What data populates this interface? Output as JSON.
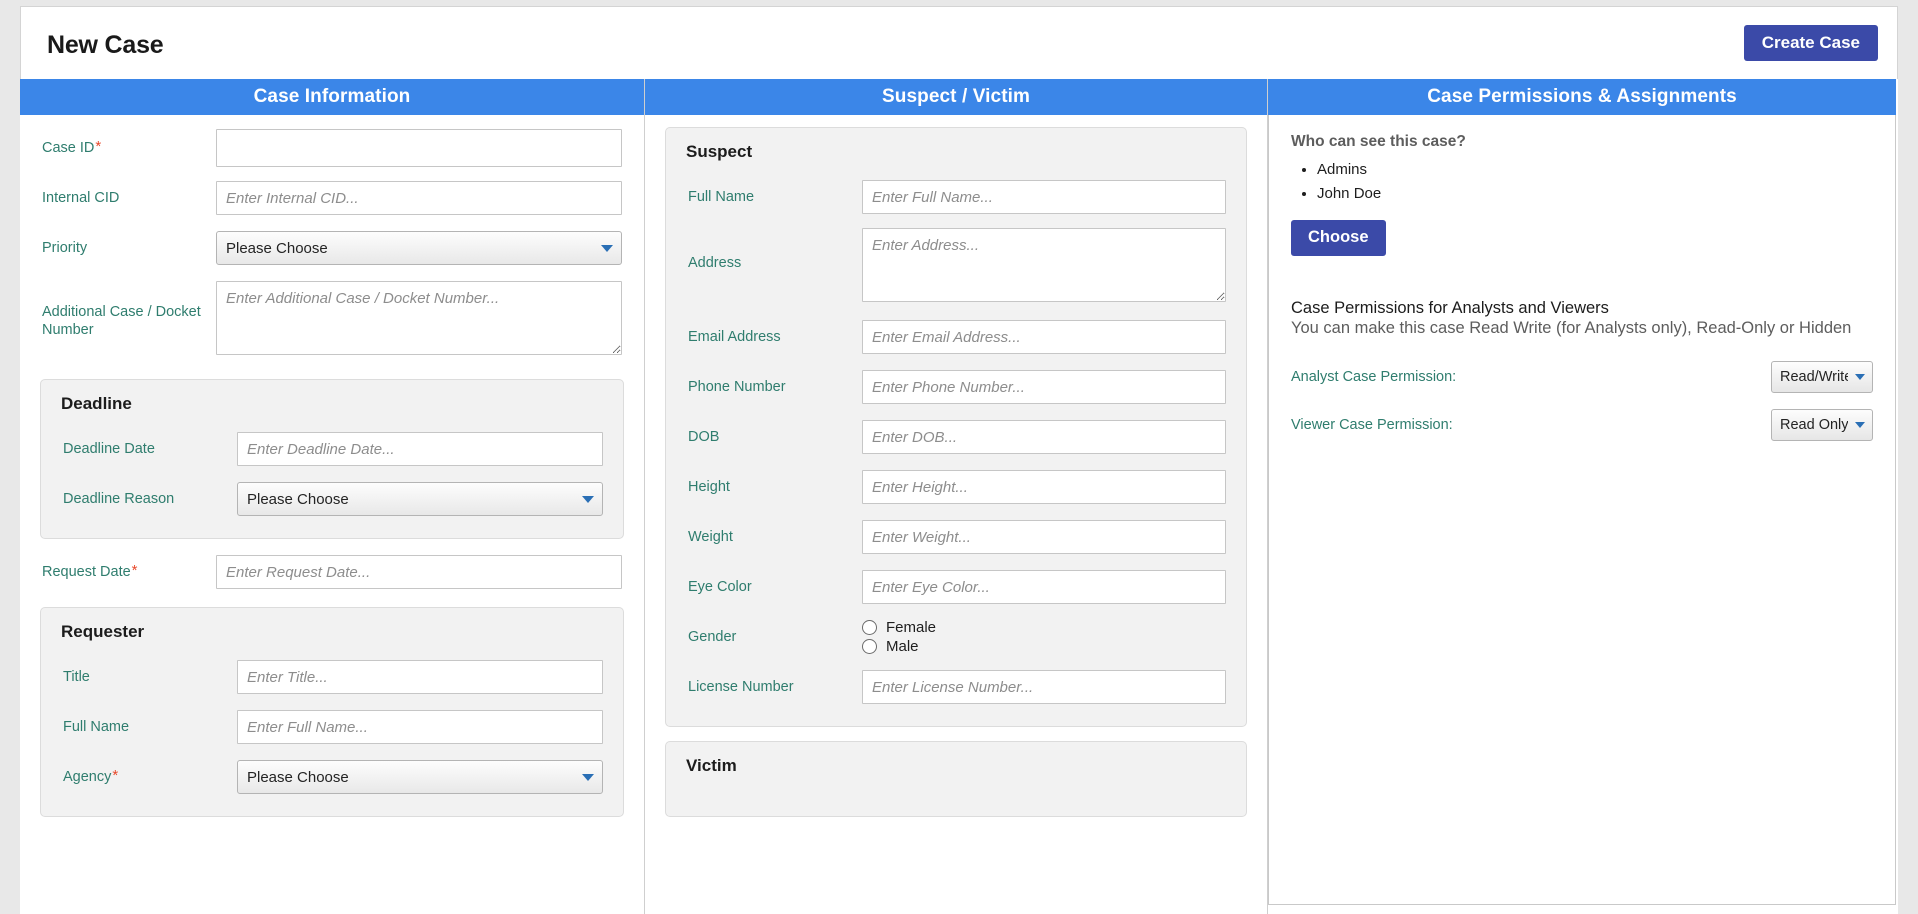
{
  "header": {
    "title": "New Case",
    "create_button": "Create Case"
  },
  "columns": [
    {
      "title": "Case Information"
    },
    {
      "title": "Suspect / Victim"
    },
    {
      "title": "Case Permissions & Assignments"
    }
  ],
  "case_information": {
    "fields": [
      {
        "label": "Case ID",
        "required": true,
        "type": "text",
        "placeholder": "",
        "value": ""
      },
      {
        "label": "Internal CID",
        "required": false,
        "type": "text",
        "placeholder": "Enter Internal CID...",
        "value": ""
      },
      {
        "label": "Priority",
        "required": false,
        "type": "select",
        "value": "Please Choose"
      },
      {
        "label": "Additional Case / Docket Number",
        "required": false,
        "type": "textarea",
        "placeholder": "Enter Additional Case / Docket Number...",
        "value": ""
      }
    ],
    "deadline_group": {
      "title": "Deadline",
      "fields": [
        {
          "label": "Deadline Date",
          "required": false,
          "type": "text",
          "placeholder": "Enter Deadline Date...",
          "value": ""
        },
        {
          "label": "Deadline Reason",
          "required": false,
          "type": "select",
          "value": "Please Choose"
        }
      ]
    },
    "request_date": {
      "label": "Request Date",
      "required": true,
      "type": "text",
      "placeholder": "Enter Request Date...",
      "value": ""
    },
    "requester_group": {
      "title": "Requester",
      "fields": [
        {
          "label": "Title",
          "required": false,
          "type": "text",
          "placeholder": "Enter Title...",
          "value": ""
        },
        {
          "label": "Full Name",
          "required": false,
          "type": "text",
          "placeholder": "Enter Full Name...",
          "value": ""
        },
        {
          "label": "Agency",
          "required": true,
          "type": "select",
          "value": "Please Choose"
        }
      ]
    }
  },
  "suspect_victim": {
    "suspect_group": {
      "title": "Suspect",
      "fields": [
        {
          "label": "Full Name",
          "type": "text",
          "placeholder": "Enter Full Name...",
          "value": ""
        },
        {
          "label": "Address",
          "type": "textarea",
          "placeholder": "Enter Address...",
          "value": ""
        },
        {
          "label": "Email Address",
          "type": "text",
          "placeholder": "Enter Email Address...",
          "value": ""
        },
        {
          "label": "Phone Number",
          "type": "text",
          "placeholder": "Enter Phone Number...",
          "value": ""
        },
        {
          "label": "DOB",
          "type": "text",
          "placeholder": "Enter DOB...",
          "value": ""
        },
        {
          "label": "Height",
          "type": "text",
          "placeholder": "Enter Height...",
          "value": ""
        },
        {
          "label": "Weight",
          "type": "text",
          "placeholder": "Enter Weight...",
          "value": ""
        },
        {
          "label": "Eye Color",
          "type": "text",
          "placeholder": "Enter Eye Color...",
          "value": ""
        },
        {
          "label": "Gender",
          "type": "radio",
          "options": [
            "Female",
            "Male"
          ],
          "selected": ""
        },
        {
          "label": "License Number",
          "type": "text",
          "placeholder": "Enter License Number...",
          "value": ""
        }
      ]
    },
    "victim_group": {
      "title": "Victim"
    }
  },
  "permissions": {
    "question": "Who can see this case?",
    "viewers": [
      "Admins",
      "John Doe"
    ],
    "choose_button": "Choose",
    "perm_heading": "Case Permissions for Analysts and Viewers",
    "perm_subtext": "You can make this case Read Write (for Analysts only), Read-Only or Hidden",
    "analyst": {
      "label": "Analyst Case Permission:",
      "value": "Read/Write"
    },
    "viewer": {
      "label": "Viewer Case Permission:",
      "value": "Read Only"
    }
  },
  "colors": {
    "panel_header_blue": "#3b86e8",
    "button_indigo": "#3b4aa8",
    "label_teal": "#2f7d6e",
    "required_red": "#e8492b"
  }
}
